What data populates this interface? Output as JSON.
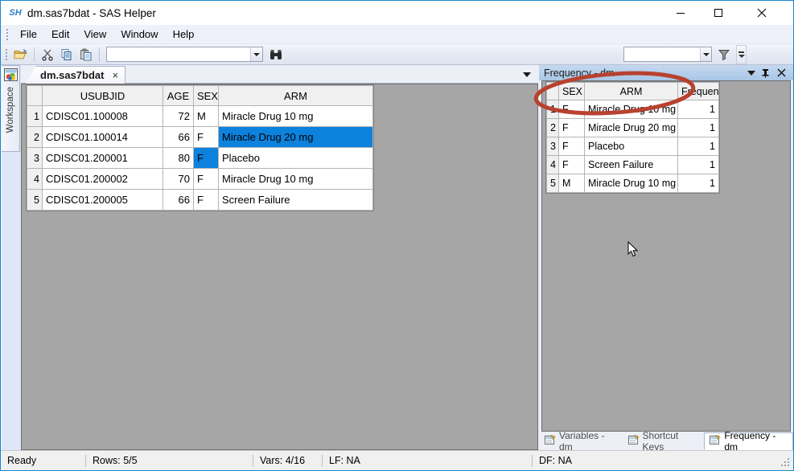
{
  "window": {
    "title": "dm.sas7bdat - SAS Helper",
    "app_icon_text": "SH",
    "minimize_label": "Minimize",
    "maximize_label": "Maximize",
    "close_label": "Close"
  },
  "menu": {
    "items": [
      {
        "label": "File"
      },
      {
        "label": "Edit"
      },
      {
        "label": "View"
      },
      {
        "label": "Window"
      },
      {
        "label": "Help"
      }
    ]
  },
  "toolbar": {
    "open_icon": "open-folder-icon",
    "cut_icon": "scissors-icon",
    "copy_icon": "copy-icon",
    "paste_icon": "paste-icon",
    "find_icon": "binoculars-icon",
    "filter_icon": "funnel-icon",
    "search_value": "",
    "search_placeholder": "",
    "filter_value": "",
    "filter_placeholder": "",
    "overflow_label": "Toolbar Options"
  },
  "workspace": {
    "label": "Workspace",
    "icon": "workspace-icon"
  },
  "document": {
    "tab_label": "dm.sas7bdat",
    "tab_close": "×",
    "dropdown_label": "Active Files"
  },
  "main_grid": {
    "columns": [
      "",
      "USUBJID",
      "AGE",
      "SEX",
      "ARM"
    ],
    "rows": [
      {
        "n": "1",
        "usubjid": "CDISC01.100008",
        "age": "72",
        "sex": "M",
        "arm": "Miracle Drug 10 mg"
      },
      {
        "n": "2",
        "usubjid": "CDISC01.100014",
        "age": "66",
        "sex": "F",
        "arm": "Miracle Drug 20 mg"
      },
      {
        "n": "3",
        "usubjid": "CDISC01.200001",
        "age": "80",
        "sex": "F",
        "arm": "Placebo"
      },
      {
        "n": "4",
        "usubjid": "CDISC01.200002",
        "age": "70",
        "sex": "F",
        "arm": "Miracle Drug 10 mg"
      },
      {
        "n": "5",
        "usubjid": "CDISC01.200005",
        "age": "66",
        "sex": "F",
        "arm": "Screen Failure"
      }
    ],
    "selected_cells": [
      {
        "row": 2,
        "column": "ARM"
      },
      {
        "row": 3,
        "column": "SEX"
      }
    ]
  },
  "right_panel": {
    "title": "Frequency - dm",
    "menu_icon": "chevron-down-icon",
    "pin_icon": "pin-icon",
    "close_icon": "close-icon",
    "grid": {
      "columns": [
        "",
        "SEX",
        "ARM",
        "Frequency"
      ],
      "rows": [
        {
          "n": "1",
          "sex": "F",
          "arm": "Miracle Drug 10 mg",
          "frequency": "1"
        },
        {
          "n": "2",
          "sex": "F",
          "arm": "Miracle Drug 20 mg",
          "frequency": "1"
        },
        {
          "n": "3",
          "sex": "F",
          "arm": "Placebo",
          "frequency": "1"
        },
        {
          "n": "4",
          "sex": "F",
          "arm": "Screen Failure",
          "frequency": "1"
        },
        {
          "n": "5",
          "sex": "M",
          "arm": "Miracle Drug 10 mg",
          "frequency": "1"
        }
      ]
    },
    "tabs": [
      {
        "label": "Variables - dm",
        "active": false
      },
      {
        "label": "Shortcut Keys",
        "active": false
      },
      {
        "label": "Frequency - dm",
        "active": true
      }
    ]
  },
  "statusbar": {
    "state": "Ready",
    "rows": "Rows: 5/5",
    "vars": "Vars: 4/16",
    "lf": "LF: NA",
    "df": "DF: NA"
  },
  "annotation": {
    "shape": "ellipse",
    "color": "#c0392b",
    "target": "Frequency grid header row"
  },
  "colors": {
    "selection_blue": "#0c82dd",
    "panel_header_blue": "#a9c6e6",
    "window_border": "#1c86d1",
    "canvas_gray": "#a6a6a6"
  }
}
